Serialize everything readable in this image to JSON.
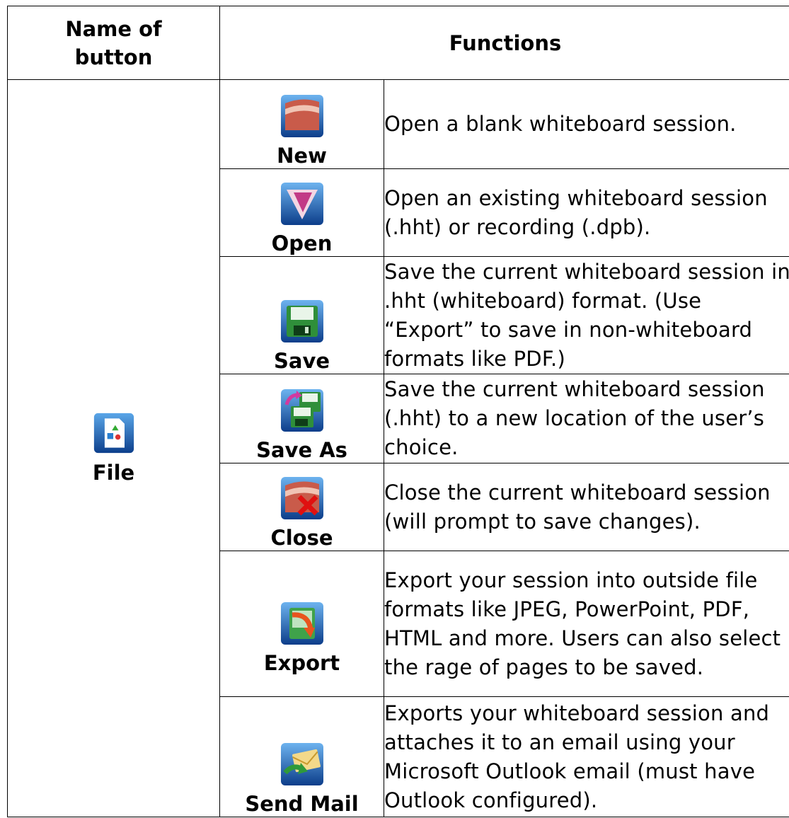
{
  "header": {
    "name_col": "Name of button",
    "functions_col": "Functions"
  },
  "group": {
    "label": "File",
    "icon": "file-icon"
  },
  "rows": [
    {
      "label": "New",
      "icon": "new-icon",
      "description": "Open a blank whiteboard session."
    },
    {
      "label": "Open",
      "icon": "open-icon",
      "description": "Open an existing whiteboard session (.hht) or recording (.dpb)."
    },
    {
      "label": "Save",
      "icon": "save-icon",
      "description": "Save the current whiteboard session in .hht (whiteboard) format. (Use “Export” to save in non-whiteboard formats like PDF.)"
    },
    {
      "label": "Save As",
      "icon": "save-as-icon",
      "description": "Save the current whiteboard session (.hht) to a new location of the user’s choice."
    },
    {
      "label": "Close",
      "icon": "close-icon",
      "description": "Close the current whiteboard session (will prompt to save changes)."
    },
    {
      "label": "Export",
      "icon": "export-icon",
      "description": "Export your session into outside file formats like JPEG, PowerPoint, PDF, HTML and more. Users can also select the rage of pages to be saved."
    },
    {
      "label": "Send Mail",
      "icon": "send-mail-icon",
      "description": "Exports your whiteboard session and attaches it to an email using your Microsoft Outlook email (must have Outlook configured)."
    }
  ]
}
